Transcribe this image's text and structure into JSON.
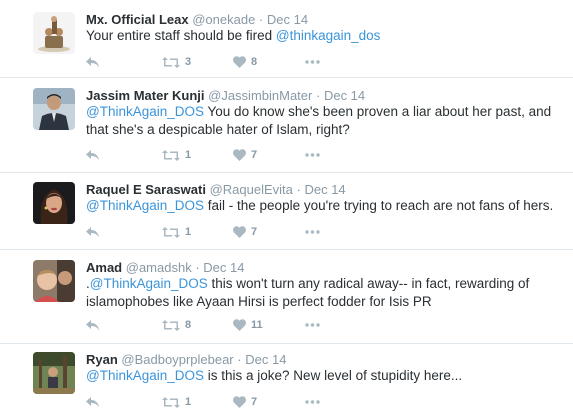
{
  "tweets": [
    {
      "fullname": "Mx. Official Leax",
      "username": "@onekade",
      "dot": "·",
      "time": "Dec 14",
      "text_before": "Your entire staff should be fired ",
      "mention": "@thinkagain_dos",
      "text_after": "",
      "retweets": "3",
      "likes": "8",
      "avatar": "avatar-figurine"
    },
    {
      "fullname": "Jassim Mater Kunji",
      "username": "@JassimbinMater",
      "dot": "·",
      "time": "Dec 14",
      "text_before": "",
      "mention": "@ThinkAgain_DOS",
      "text_after": " You do know she's been proven a liar about her past, and that she's a despicable hater of Islam, right?",
      "retweets": "1",
      "likes": "7",
      "avatar": "avatar-man-suit"
    },
    {
      "fullname": "Raquel E Saraswati",
      "username": "@RaquelEvita",
      "dot": "·",
      "time": "Dec 14",
      "text_before": "",
      "mention": "@ThinkAgain_DOS",
      "text_after": " fail - the people you're trying to reach are not fans of hers.",
      "retweets": "1",
      "likes": "7",
      "avatar": "avatar-woman"
    },
    {
      "fullname": "Amad",
      "username": "@amadshk",
      "dot": "·",
      "time": "Dec 14",
      "text_before": ".",
      "mention": "@ThinkAgain_DOS",
      "text_after": " this won't turn any radical away-- in fact, rewarding of islamophobes like Ayaan Hirsi is perfect fodder for Isis PR",
      "retweets": "8",
      "likes": "11",
      "avatar": "avatar-child"
    },
    {
      "fullname": "Ryan",
      "username": "@Badboyprplebear",
      "dot": "·",
      "time": "Dec 14",
      "text_before": "",
      "mention": "@ThinkAgain_DOS",
      "text_after": " is this a joke? New level of stupidity here...",
      "retweets": "1",
      "likes": "7",
      "avatar": "avatar-outdoor"
    }
  ],
  "colors": {
    "name": "#292f33",
    "meta": "#8899a6",
    "link": "#3b94d9",
    "icon": "#aab8c2",
    "divider": "#e1e8ed"
  }
}
